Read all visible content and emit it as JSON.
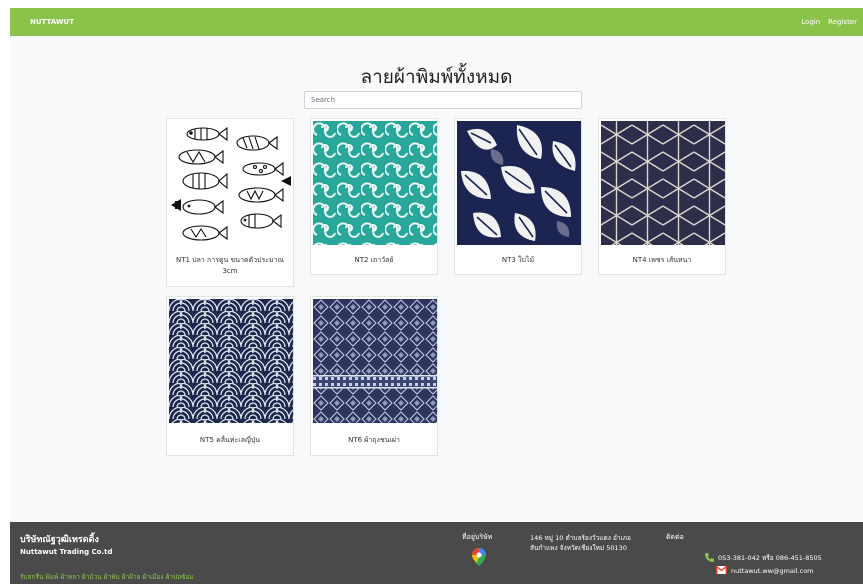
{
  "navbar": {
    "brand": "NUTTAWUT",
    "login": "Login",
    "register": "Register"
  },
  "page_title": "ลายผ้าพิมพ์ทั้งหมด",
  "search": {
    "placeholder": "Search",
    "value": ""
  },
  "products": [
    {
      "caption": "NT1 ปลา การตูน ขนาดตัวประมาณ 3cm",
      "pattern": "fish-cartoon"
    },
    {
      "caption": "NT2 เถาวัลย์",
      "pattern": "teal-swirl"
    },
    {
      "caption": "NT3 ใบไม้",
      "pattern": "monstera-leaf"
    },
    {
      "caption": "NT4 เพชร เส้นหนา",
      "pattern": "asanoha-star"
    },
    {
      "caption": "NT5 คลื่นทะเลญี่ปุ่น",
      "pattern": "seigaiha-wave"
    },
    {
      "caption": "NT6 ผ้าถุงชนเผ่า",
      "pattern": "tribal-diamond"
    }
  ],
  "footer": {
    "company_th": "บริษัทณัฐวุฒิเทรดดิ้ง",
    "company_en": "Nuttawut Trading Co.td",
    "services": "รับสกรีน พิมพ์ ผ้าหลา ผ้าม้วน ผ้าพับ ผ้าฝ้าย ผ้าเมือง ผ้าปอซ้อม",
    "location_label": "ที่อยู่บริษัท",
    "address_line1": "146 หมู่ 10 ตำบลร้องวัวแดง อำเภอ",
    "address_line2": "สันกำแพง จังหวัดเชียงใหม่ 50130",
    "contact_label": "ติดต่อ",
    "phone": "053-381-042 หรือ 086-451-8505",
    "email": "nuttawut.ww@gmail.com"
  },
  "colors": {
    "navbar": "#8bc34a",
    "footer": "#4a4a4a",
    "accent": "#8bc34a"
  }
}
